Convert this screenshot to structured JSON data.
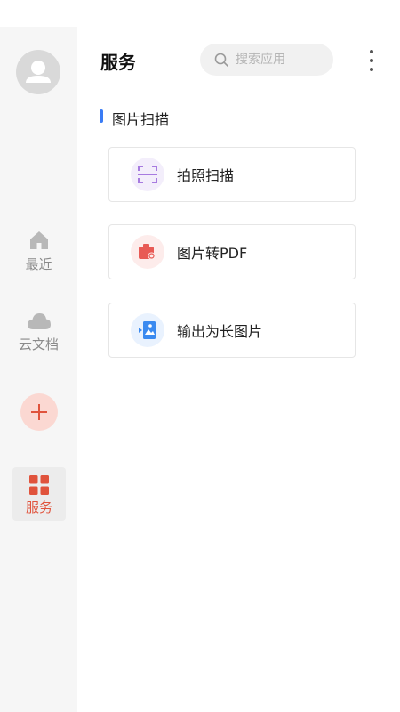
{
  "header": {
    "title": "服务",
    "search_placeholder": "搜索应用"
  },
  "sidebar": {
    "items": [
      {
        "label": "最近",
        "icon": "home-icon"
      },
      {
        "label": "云文档",
        "icon": "cloud-icon"
      },
      {
        "label": "服务",
        "icon": "grid-icon",
        "active": true
      }
    ],
    "add_icon": "plus-icon",
    "accent": "#e0533c"
  },
  "section": {
    "title": "图片扫描"
  },
  "services": [
    {
      "label": "拍照扫描",
      "icon": "scan-icon",
      "color": "#a77be0"
    },
    {
      "label": "图片转PDF",
      "icon": "image-to-pdf-icon",
      "color": "#e85a55"
    },
    {
      "label": "输出为长图片",
      "icon": "long-image-icon",
      "color": "#3a8af0"
    }
  ]
}
